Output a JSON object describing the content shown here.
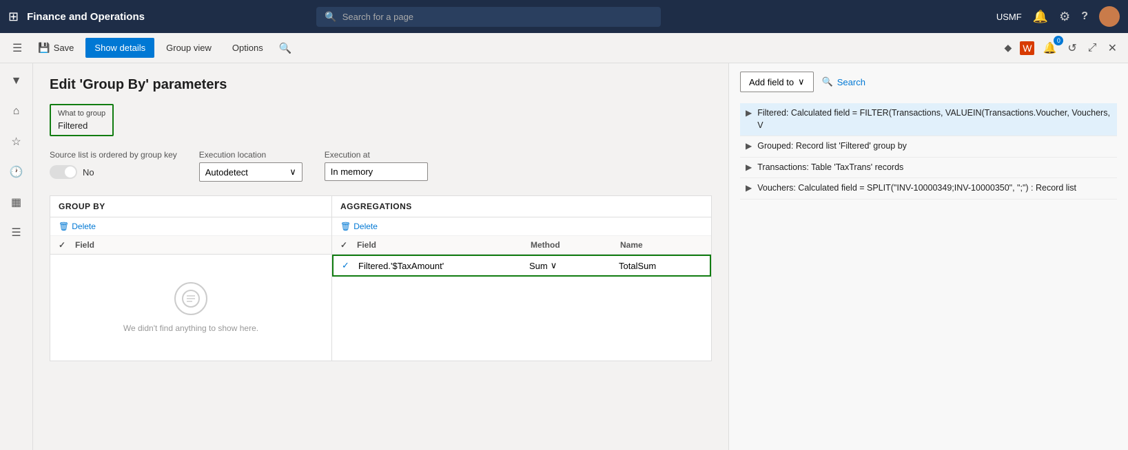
{
  "app": {
    "title": "Finance and Operations",
    "nav_search_placeholder": "Search for a page",
    "user_code": "USMF"
  },
  "toolbar": {
    "save_label": "Save",
    "show_details_label": "Show details",
    "group_view_label": "Group view",
    "options_label": "Options"
  },
  "page": {
    "title": "Edit 'Group By' parameters"
  },
  "what_to_group": {
    "label": "What to group",
    "value": "Filtered"
  },
  "form": {
    "source_list_label": "Source list is ordered by group key",
    "toggle_state": "off",
    "toggle_text": "No",
    "execution_location_label": "Execution location",
    "execution_location_value": "Autodetect",
    "execution_at_label": "Execution at",
    "execution_at_value": "In memory"
  },
  "group_by": {
    "header": "GROUP BY",
    "delete_label": "Delete",
    "column_field": "Field",
    "empty_message": "We didn't find anything to show here."
  },
  "aggregations": {
    "header": "AGGREGATIONS",
    "delete_label": "Delete",
    "column_field": "Field",
    "column_method": "Method",
    "column_name": "Name",
    "row": {
      "field": "Filtered.'$TaxAmount'",
      "method": "Sum",
      "name": "TotalSum"
    }
  },
  "right_panel": {
    "add_field_to_label": "Add field to",
    "search_label": "Search",
    "tree_items": [
      {
        "text": "Filtered: Calculated field = FILTER(Transactions, VALUEIN(Transactions.Voucher, Vouchers, V",
        "highlighted": true
      },
      {
        "text": "Grouped: Record list 'Filtered' group by",
        "highlighted": false
      },
      {
        "text": "Transactions: Table 'TaxTrans' records",
        "highlighted": false
      },
      {
        "text": "Vouchers: Calculated field = SPLIT(\"INV-10000349;INV-10000350\", \";\") : Record list",
        "highlighted": false
      }
    ]
  },
  "icons": {
    "grid": "⊞",
    "search": "🔍",
    "bell": "🔔",
    "gear": "⚙",
    "help": "?",
    "home": "⌂",
    "star": "☆",
    "clock": "🕐",
    "table": "▦",
    "list": "☰",
    "filter": "▼",
    "save": "💾",
    "close": "✕",
    "delete_trash": "🗑",
    "chevron_down": "∨",
    "arrow_right": "▶",
    "refresh": "↺",
    "expand": "⤢",
    "magic": "✦",
    "ms_icon": "⬛",
    "diamond": "◆"
  }
}
